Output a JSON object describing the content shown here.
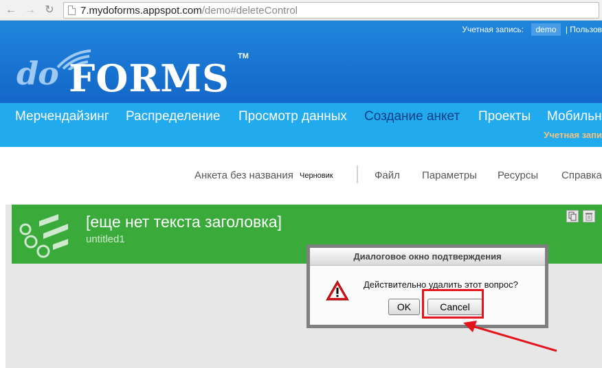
{
  "browser": {
    "back_icon": "back-arrow-icon",
    "forward_icon": "forward-arrow-icon",
    "reload_icon": "reload-icon",
    "url_host": "7.mydoforms.appspot.com",
    "url_path": "/demo#deleteControl"
  },
  "header": {
    "account_label": "Учетная запись:",
    "account_user": "demo",
    "account_extra": "| Пользов",
    "logo_do": "do",
    "logo_forms": "FORMS",
    "logo_tm": "TM"
  },
  "menu": {
    "items": [
      {
        "label": "Мерчендайзинг",
        "active": false
      },
      {
        "label": "Распределение",
        "active": false
      },
      {
        "label": "Просмотр данных",
        "active": false
      },
      {
        "label": "Создание анкет",
        "active": true
      },
      {
        "label": "Проекты",
        "active": false
      },
      {
        "label": "Мобильн",
        "active": false
      }
    ],
    "sub_label": "Учетная запи"
  },
  "toolbar": {
    "form_name": "Анкета без названия",
    "status": "Черновик",
    "file": "Файл",
    "params": "Параметры",
    "resources": "Ресурсы",
    "help": "Справка"
  },
  "form_header": {
    "title": "[еще нет текста заголовка]",
    "subtitle": "untitled1",
    "copy_icon": "copy-icon",
    "delete_icon": "trash-icon"
  },
  "dialog": {
    "title": "Диалоговое окно подтверждения",
    "message": "Действительно удалить этот вопрос?",
    "ok_label": "OK",
    "cancel_label": "Cancel",
    "icon": "warning-icon"
  },
  "colors": {
    "header_blue": "#1466c8",
    "menu_blue": "#22aaee",
    "active_menu": "#0d3f86",
    "form_green": "#3aaa3a",
    "annotation_red": "#e3141b"
  }
}
